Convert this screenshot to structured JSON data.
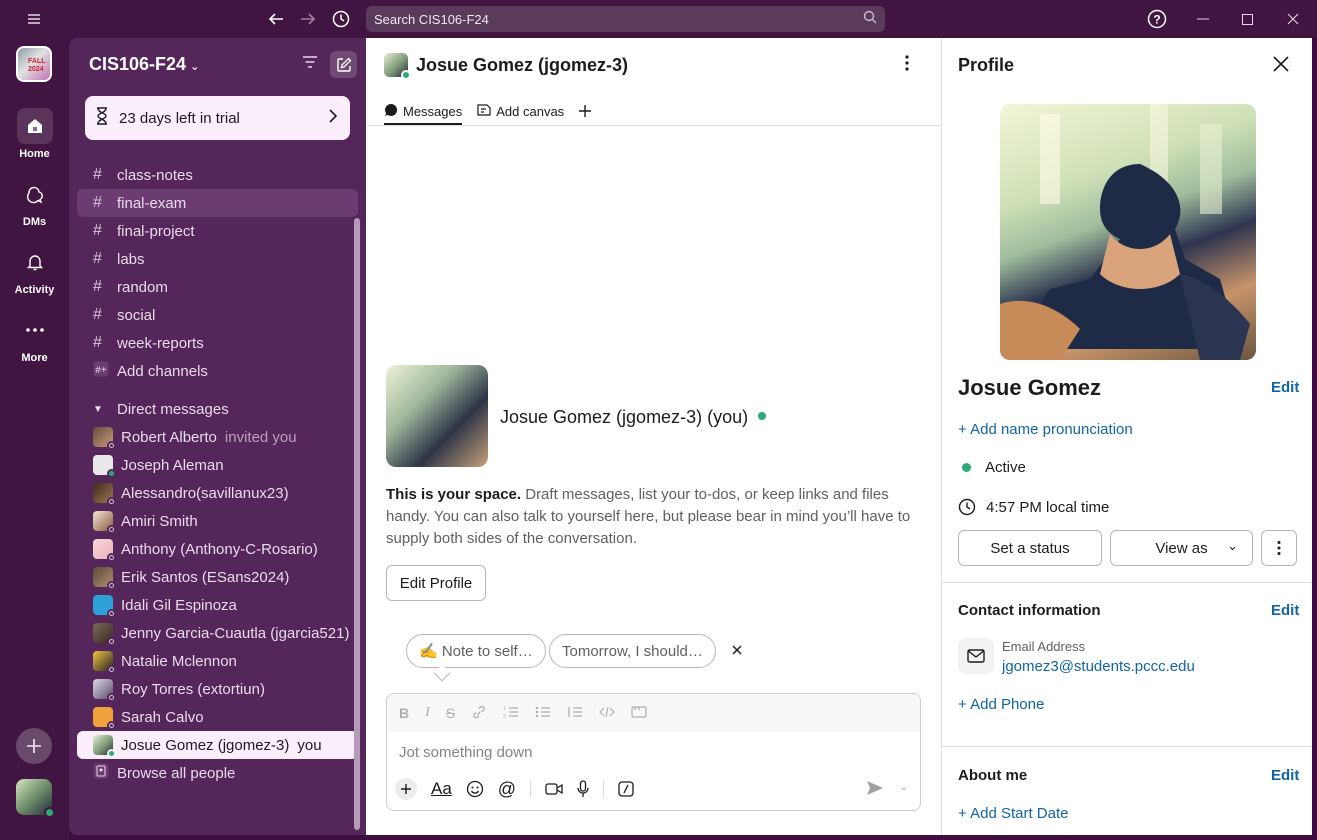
{
  "search": {
    "placeholder": "Search CIS106-F24"
  },
  "workspace": {
    "name": "CIS106-F24"
  },
  "rail": {
    "items": [
      {
        "label": "Home"
      },
      {
        "label": "DMs"
      },
      {
        "label": "Activity"
      },
      {
        "label": "More"
      }
    ]
  },
  "sidebar": {
    "trial": "23 days left in trial",
    "channels": [
      "class-notes",
      "final-exam",
      "final-project",
      "labs",
      "random",
      "social",
      "week-reports"
    ],
    "selected_channel": "final-exam",
    "add_channels": "Add channels",
    "dm_header": "Direct messages",
    "dms": [
      {
        "name": "Robert Alberto",
        "note": "invited you"
      },
      {
        "name": "Joseph Aleman",
        "note": ""
      },
      {
        "name": "Alessandro(savillanux23)",
        "note": ""
      },
      {
        "name": "Amiri Smith",
        "note": ""
      },
      {
        "name": "Anthony (Anthony-C-Rosario)",
        "note": ""
      },
      {
        "name": "Erik Santos (ESans2024)",
        "note": ""
      },
      {
        "name": "Idali Gil Espinoza",
        "note": ""
      },
      {
        "name": "Jenny Garcia-Cuautla (jgarcia521)",
        "note": ""
      },
      {
        "name": "Natalie Mclennon",
        "note": ""
      },
      {
        "name": "Roy Torres (extortiun)",
        "note": ""
      },
      {
        "name": "Sarah Calvo",
        "note": ""
      },
      {
        "name": "Josue Gomez (jgomez-3)",
        "note": "you"
      }
    ],
    "browse": "Browse all people"
  },
  "main": {
    "title": "Josue Gomez (jgomez-3)",
    "tabs": [
      "Messages",
      "Add canvas"
    ],
    "intro_name": "Josue Gomez (jgomez-3) (you)",
    "intro_bold": "This is your space.",
    "intro_rest": " Draft messages, list your to-dos, or keep links and files handy. You can also talk to yourself here, but please bear in mind you’ll have to supply both sides of the conversation.",
    "edit_profile": "Edit Profile",
    "suggestions": [
      "✍️ Note to self…",
      "Tomorrow, I should…"
    ],
    "composer_placeholder": "Jot something down"
  },
  "profile": {
    "title": "Profile",
    "name": "Josue Gomez",
    "edit": "Edit",
    "add_pronunciation": "+ Add name pronunciation",
    "status": "Active",
    "local_time": "4:57 PM local time",
    "set_status": "Set a status",
    "view_as": "View as",
    "contact_title": "Contact information",
    "email_label": "Email Address",
    "email": "jgomez3@students.pccc.edu",
    "add_phone": "+ Add Phone",
    "about_title": "About me",
    "add_start_date": "+ Add Start Date"
  },
  "colors": {
    "brand": "#3f0e40",
    "sidebar": "#54265a",
    "link": "#1264a3",
    "presence": "#2bac76"
  }
}
